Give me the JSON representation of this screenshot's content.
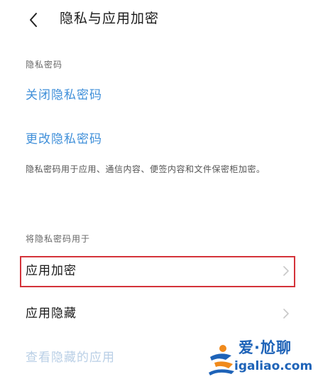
{
  "header": {
    "title": "隐私与应用加密",
    "back_icon": "chevron-left-icon"
  },
  "privacy_password": {
    "section_label": "隐私密码",
    "close_link": "关闭隐私密码",
    "change_link": "更改隐私密码",
    "description": "隐私密码用于应用、通信内容、便签内容和文件保密柜加密。"
  },
  "usage": {
    "section_label": "将隐私密码用于",
    "items": [
      {
        "label": "应用加密",
        "highlighted": true
      },
      {
        "label": "应用隐藏",
        "highlighted": false
      }
    ],
    "disabled_item": "查看隐藏的应用"
  },
  "watermark": {
    "top_text": "爱·尬聊",
    "bottom_text": "igaliao.com"
  },
  "colors": {
    "accent_blue": "#3f8fd9",
    "highlight_red": "#d4333a",
    "disabled_blue": "#b9cfe6",
    "watermark_blue": "#1e63b8",
    "watermark_orange": "#f08a1c"
  }
}
